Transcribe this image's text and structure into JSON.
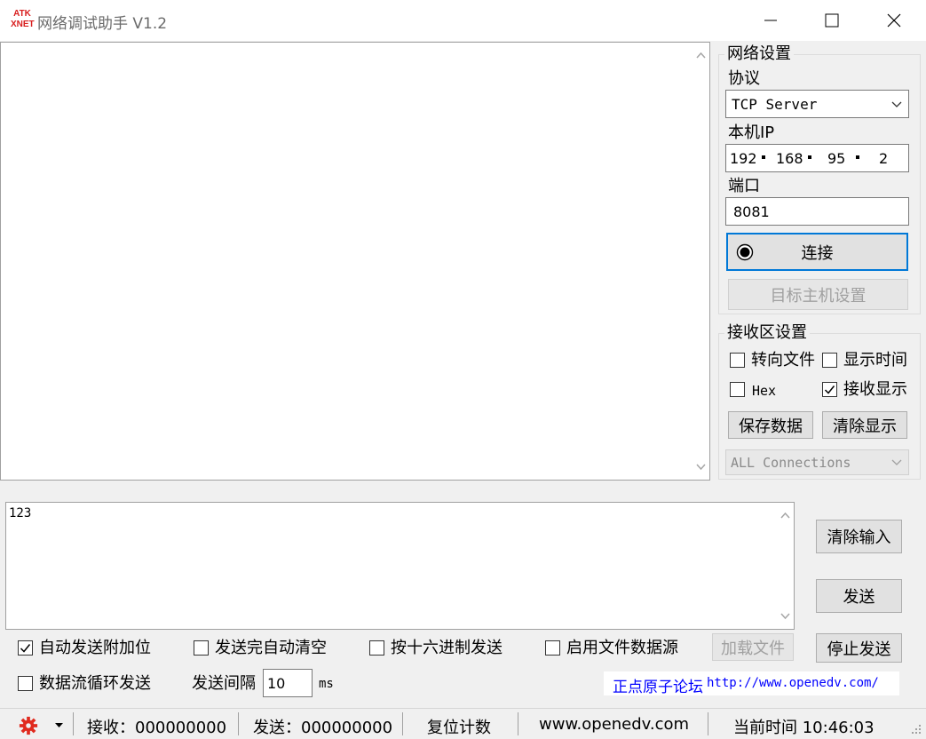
{
  "window": {
    "logo_line1": "ATK",
    "logo_line2": "XNET",
    "title": "网络调试助手 V1.2"
  },
  "network_settings": {
    "group_title": "网络设置",
    "protocol_label": "协议",
    "protocol_value": "TCP Server",
    "local_ip_label": "本机IP",
    "ip_octets": [
      "192",
      "168",
      "95",
      "2"
    ],
    "port_label": "端口",
    "port_value": "8081",
    "connect_button": "连接",
    "target_host_button": "目标主机设置"
  },
  "receive_settings": {
    "group_title": "接收区设置",
    "redirect_file": {
      "label": "转向文件",
      "checked": false
    },
    "show_time": {
      "label": "显示时间",
      "checked": false
    },
    "hex": {
      "label": "Hex",
      "checked": false
    },
    "receive_display": {
      "label": "接收显示",
      "checked": true
    },
    "save_data_button": "保存数据",
    "clear_display_button": "清除显示",
    "connections_select": "ALL Connections"
  },
  "send_area": {
    "text": "123",
    "clear_input_button": "清除输入",
    "send_button": "发送",
    "stop_send_button": "停止发送",
    "load_file_button": "加载文件",
    "options": {
      "auto_append": {
        "label": "自动发送附加位",
        "checked": true
      },
      "auto_clear": {
        "label": "发送完自动清空",
        "checked": false
      },
      "hex_send": {
        "label": "按十六进制发送",
        "checked": false
      },
      "file_source": {
        "label": "启用文件数据源",
        "checked": false
      },
      "loop_send": {
        "label": "数据流循环发送",
        "checked": false
      }
    },
    "interval_label": "发送间隔",
    "interval_value": "10",
    "interval_unit": "ms",
    "brand_text": "正点原子论坛",
    "brand_url": "http://www.openedv.com/"
  },
  "status_bar": {
    "receive": "接收：000000000",
    "send": "发送：000000000",
    "reset_count": "复位计数",
    "website": "www.openedv.com",
    "current_time": "当前时间 10:46:03"
  },
  "colors": {
    "logo_red": "#d81e1e",
    "link_blue": "#0000ff",
    "focus_blue": "#0078d7",
    "settings_icon": "#e02a1e"
  }
}
